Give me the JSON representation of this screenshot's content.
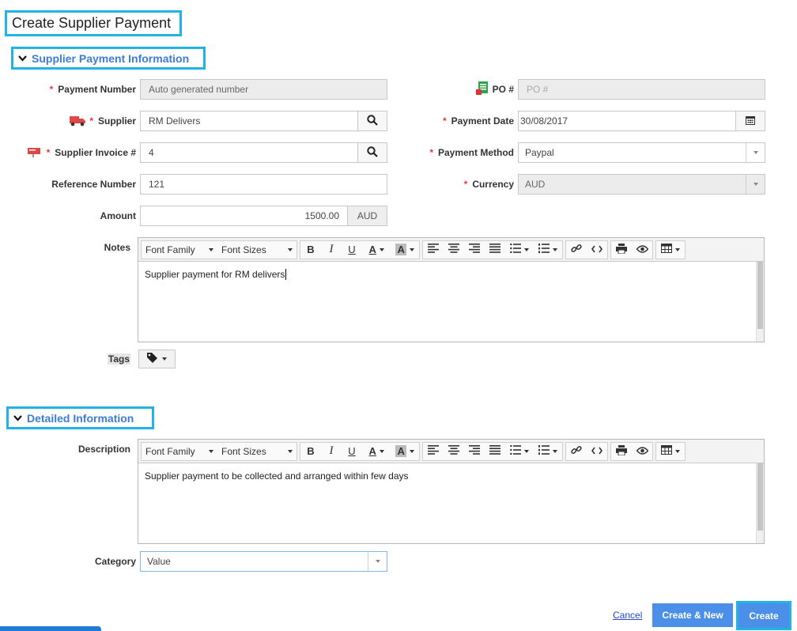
{
  "page_title": "Create Supplier Payment",
  "sections": {
    "supplier_payment": "Supplier Payment Information",
    "detailed": "Detailed Information"
  },
  "fields": {
    "payment_number": {
      "label": "Payment Number",
      "value": "Auto generated number"
    },
    "po": {
      "label": "PO #",
      "placeholder": "PO #"
    },
    "supplier": {
      "label": "Supplier",
      "value": "RM Delivers"
    },
    "payment_date": {
      "label": "Payment Date",
      "value": "30/08/2017"
    },
    "supplier_invoice": {
      "label": "Supplier Invoice #",
      "value": "4"
    },
    "payment_method": {
      "label": "Payment Method",
      "value": "Paypal"
    },
    "reference_number": {
      "label": "Reference Number",
      "value": "121"
    },
    "currency": {
      "label": "Currency",
      "value": "AUD"
    },
    "amount": {
      "label": "Amount",
      "value": "1500.00",
      "currency": "AUD"
    },
    "notes": {
      "label": "Notes",
      "value": "Supplier payment for RM delivers"
    },
    "tags": {
      "label": "Tags"
    },
    "description": {
      "label": "Description",
      "value": "Supplier payment to be collected and arranged within few days"
    },
    "category": {
      "label": "Category",
      "value": "Value"
    }
  },
  "toolbar": {
    "font_family": "Font Family",
    "font_sizes": "Font Sizes",
    "bold": "B",
    "italic": "I",
    "underline": "U",
    "font_color": "A",
    "bg_color": "A"
  },
  "footer": {
    "cancel": "Cancel",
    "create_new": "Create & New",
    "create": "Create"
  },
  "colors": {
    "highlight": "#1fb3e6",
    "section_title": "#3b7dd8",
    "primary_button": "#4c8fe8",
    "required": "#e03b3b"
  }
}
